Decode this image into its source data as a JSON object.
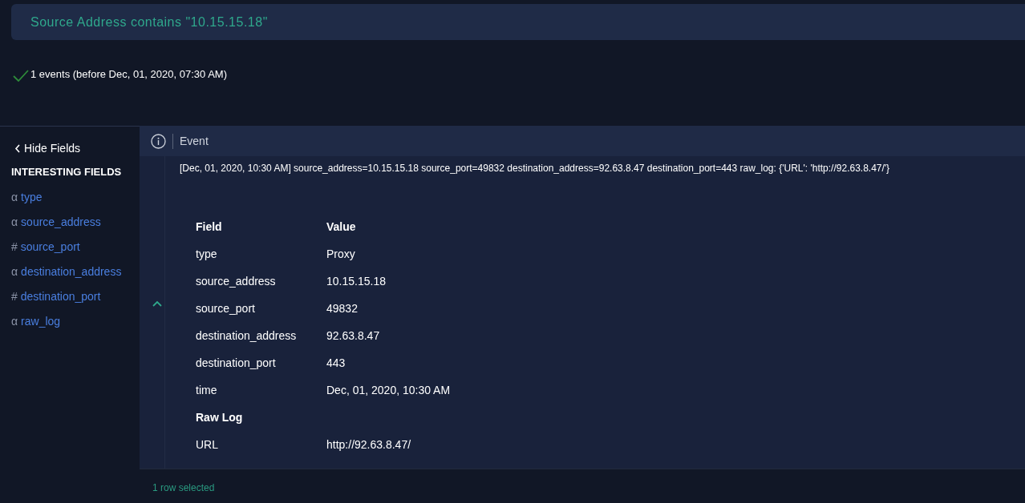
{
  "query": {
    "text": "Source Address contains \"10.15.15.18\""
  },
  "result_summary": {
    "text": "1 events (before Dec, 01, 2020, 07:30 AM)",
    "success": true
  },
  "sidebar": {
    "toggle": "Hide Fields",
    "heading": "INTERESTING FIELDS",
    "fields": [
      {
        "type_symbol": "α",
        "name": "type"
      },
      {
        "type_symbol": "α",
        "name": "source_address"
      },
      {
        "type_symbol": "#",
        "name": "source_port"
      },
      {
        "type_symbol": "α",
        "name": "destination_address"
      },
      {
        "type_symbol": "#",
        "name": "destination_port"
      },
      {
        "type_symbol": "α",
        "name": "raw_log"
      }
    ]
  },
  "event_table": {
    "column": "Event",
    "expanded": true,
    "raw_event": "[Dec, 01, 2020, 10:30 AM] source_address=10.15.15.18 source_port=49832 destination_address=92.63.8.47 destination_port=443 raw_log: {'URL': 'http://92.63.8.47/'}",
    "details": [
      {
        "kind": "header",
        "field": "Field",
        "value": "Value"
      },
      {
        "kind": "field",
        "field": "type",
        "value": "Proxy"
      },
      {
        "kind": "field",
        "field": "source_address",
        "value": "10.15.15.18"
      },
      {
        "kind": "field",
        "field": "source_port",
        "value": "49832"
      },
      {
        "kind": "field",
        "field": "destination_address",
        "value": "92.63.8.47"
      },
      {
        "kind": "field",
        "field": "destination_port",
        "value": "443"
      },
      {
        "kind": "field",
        "field": "time",
        "value": "Dec, 01, 2020, 10:30 AM"
      },
      {
        "kind": "section",
        "field": "Raw Log"
      },
      {
        "kind": "field",
        "field": "URL",
        "value": "http://92.63.8.47/"
      }
    ]
  },
  "status_bar": {
    "text": "1 row selected"
  }
}
